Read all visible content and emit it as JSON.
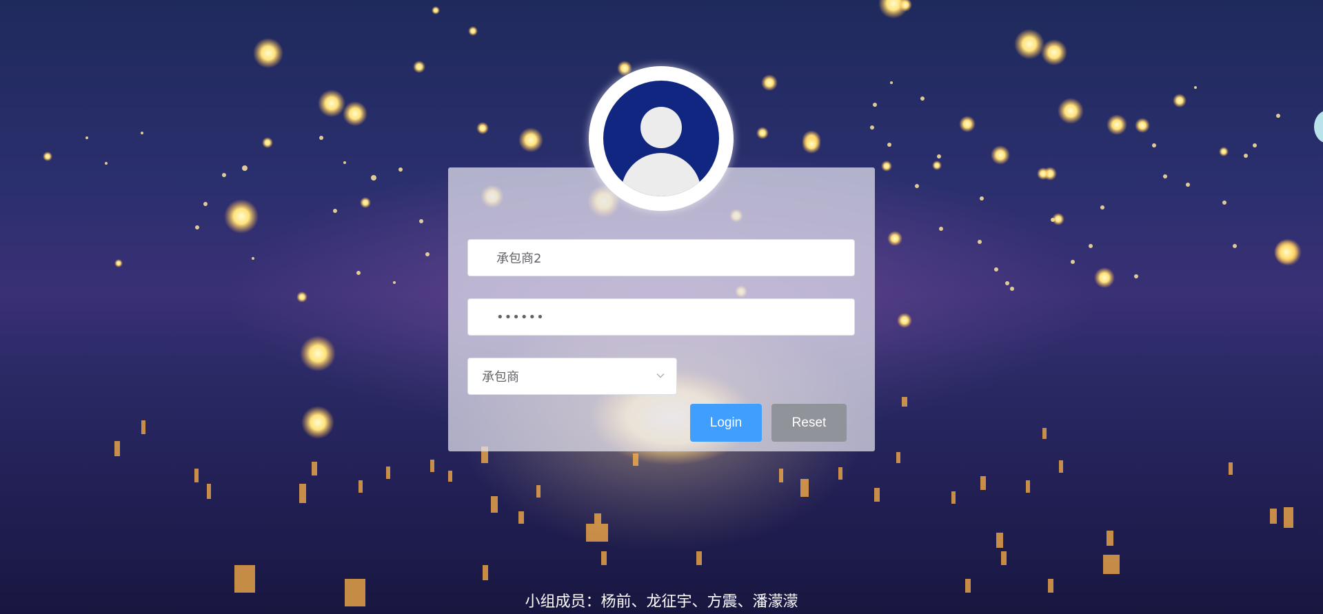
{
  "form": {
    "username_value": "承包商2",
    "password_value": "••••••",
    "role_selected": "承包商"
  },
  "buttons": {
    "login_label": "Login",
    "reset_label": "Reset"
  },
  "footer": {
    "text": "小组成员：杨前、龙征宇、方震、潘濛濛"
  },
  "colors": {
    "primary": "#409eff",
    "secondary": "#909399",
    "avatar_bg": "#102680"
  },
  "icons": {
    "avatar": "user-avatar-icon",
    "select_arrow": "chevron-down-icon"
  }
}
